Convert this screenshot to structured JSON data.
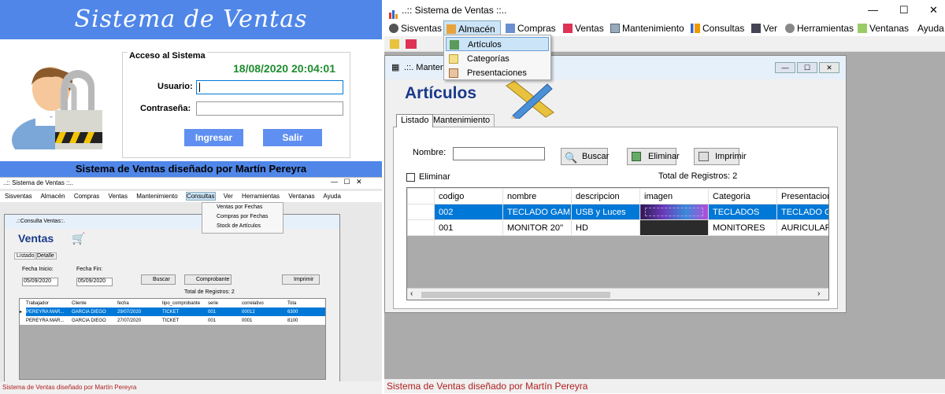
{
  "login": {
    "title": "Sistema de Ventas",
    "box_title": "Acceso al Sistema",
    "datetime": "18/08/2020 20:04:01",
    "user_label": "Usuario:",
    "password_label": "Contraseña:",
    "login_button": "Ingresar",
    "exit_button": "Salir",
    "footer": "Sistema de Ventas diseñado por Martín Pereyra"
  },
  "small": {
    "app_title": "..:: Sistema de Ventas ::..",
    "menu": [
      "Sisventas",
      "Almacén",
      "Compras",
      "Ventas",
      "Mantenimiento",
      "Consultas",
      "Ver",
      "Herramientas",
      "Ventanas",
      "Ayuda"
    ],
    "dropdown": [
      "Ventas por Fechas",
      "Compras por Fechas",
      "Stock de Artículos"
    ],
    "child_title": ".::Consulta Ventas::.",
    "heading": "Ventas",
    "tabs": [
      "Listado",
      "Detalle"
    ],
    "date_start_label": "Fecha Inicio:",
    "date_end_label": "Fecha Fin:",
    "date_start": "05/09/2020",
    "date_end": "05/09/2020",
    "search_button": "Buscar",
    "voucher_button": "Comprobante",
    "print_button": "Imprimir",
    "total": "Total de Registros: 2",
    "columns": [
      "Trabajador",
      "Cliente",
      "fecha",
      "tipo_comprobante",
      "serie",
      "correlativo",
      "Tota"
    ],
    "rows": [
      [
        "PEREYRA MAR...",
        "GARCIA DIEGO",
        "29/07/2020",
        "TICKET",
        "001",
        "00012",
        "6300"
      ],
      [
        "PEREYRA MAR...",
        "GARCIA DIEGO",
        "27/07/2020",
        "TICKET",
        "001",
        "0001",
        "8100"
      ]
    ],
    "footer": "Sistema de Ventas diseñado por Martín Pereyra"
  },
  "big": {
    "app_title": "..:: Sistema de Ventas ::..",
    "menu": [
      "Sisventas",
      "Almacén",
      "Compras",
      "Ventas",
      "Mantenimiento",
      "Consultas",
      "Ver",
      "Herramientas",
      "Ventanas",
      "Ayuda"
    ],
    "dropdown": [
      "Artículos",
      "Categorías",
      "Presentaciones"
    ],
    "child_title": ".::. Mantenimiento Artículos .::.",
    "heading": "Artículos",
    "tabs": [
      "Listado",
      "Mantenimiento"
    ],
    "name_label": "Nombre:",
    "search_button": "Buscar",
    "delete_button": "Eliminar",
    "print_button": "Imprimir",
    "delete_check": "Eliminar",
    "total": "Total de Registros: 2",
    "columns": [
      "codigo",
      "nombre",
      "descripcion",
      "imagen",
      "Categoria",
      "Presentacion"
    ],
    "rows": [
      {
        "codigo": "002",
        "nombre": "TECLADO GAMER",
        "descripcion": "USB y Luces",
        "categoria": "TECLADOS",
        "presentacion": "TECLADO GA"
      },
      {
        "codigo": "001",
        "nombre": "MONITOR 20''",
        "descripcion": "HD",
        "categoria": "MONITORES",
        "presentacion": "AURICULARE"
      }
    ],
    "status": "Sistema de Ventas diseñado por Martín Pereyra"
  },
  "colors": {
    "accent": "#4f86e8",
    "selection": "#0078d7",
    "status_text": "#b02020",
    "datetime": "#1e8c2e"
  }
}
